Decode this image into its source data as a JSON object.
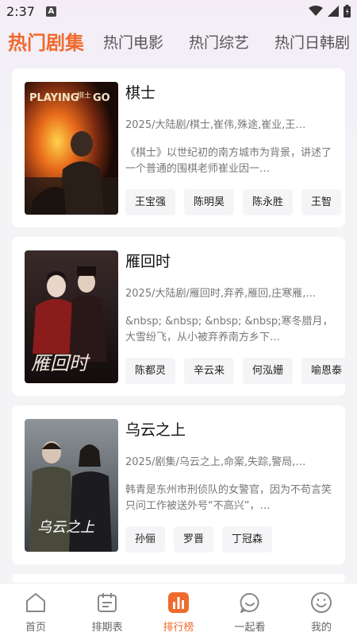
{
  "status_bar": {
    "time": "2:37",
    "notification_badge": "A"
  },
  "tabs": [
    {
      "label": "热门剧集",
      "active": true
    },
    {
      "label": "热门电影",
      "active": false
    },
    {
      "label": "热门综艺",
      "active": false
    },
    {
      "label": "热门日韩剧",
      "active": false
    }
  ],
  "poster_texts": {
    "p1_en": "PLAYING",
    "p1_go": "GO",
    "p1_cn": "棋士",
    "p2_cn": "雁回时",
    "p3_cn": "乌云之上"
  },
  "cards": [
    {
      "title": "棋士",
      "meta": "2025/大陆剧/棋士,崔伟,殊途,崔业,王…",
      "desc": "《棋士》以世纪初的南方城市为背景，讲述了一个普通的围棋老师崔业因一…",
      "actors": [
        "王宝强",
        "陈明昊",
        "陈永胜",
        "王智"
      ]
    },
    {
      "title": "雁回时",
      "meta": "2025/大陆剧/雁回时,弃养,雁回,庄寒雁,…",
      "desc": "&nbsp; &nbsp; &nbsp; &nbsp;寒冬腊月，大雪纷飞，从小被弃养南方乡下…",
      "actors": [
        "陈都灵",
        "辛云来",
        "何泓姗",
        "喻恩泰"
      ]
    },
    {
      "title": "乌云之上",
      "meta": "2025/剧集/乌云之上,命案,失踪,警局,…",
      "desc": "韩青是东州市刑侦队的女警官，因为不苟言笑只问工作被送外号“不高兴”，…",
      "actors": [
        "孙俪",
        "罗晋",
        "丁冠森"
      ]
    }
  ],
  "bottom_nav": [
    {
      "label": "首页",
      "icon": "home-icon",
      "active": false
    },
    {
      "label": "排期表",
      "icon": "calendar-icon",
      "active": false
    },
    {
      "label": "排行榜",
      "icon": "ranking-icon",
      "active": true
    },
    {
      "label": "一起看",
      "icon": "smile-bubble-icon",
      "active": false
    },
    {
      "label": "我的",
      "icon": "profile-smile-icon",
      "active": false
    }
  ],
  "colors": {
    "accent": "#f06a2c"
  }
}
